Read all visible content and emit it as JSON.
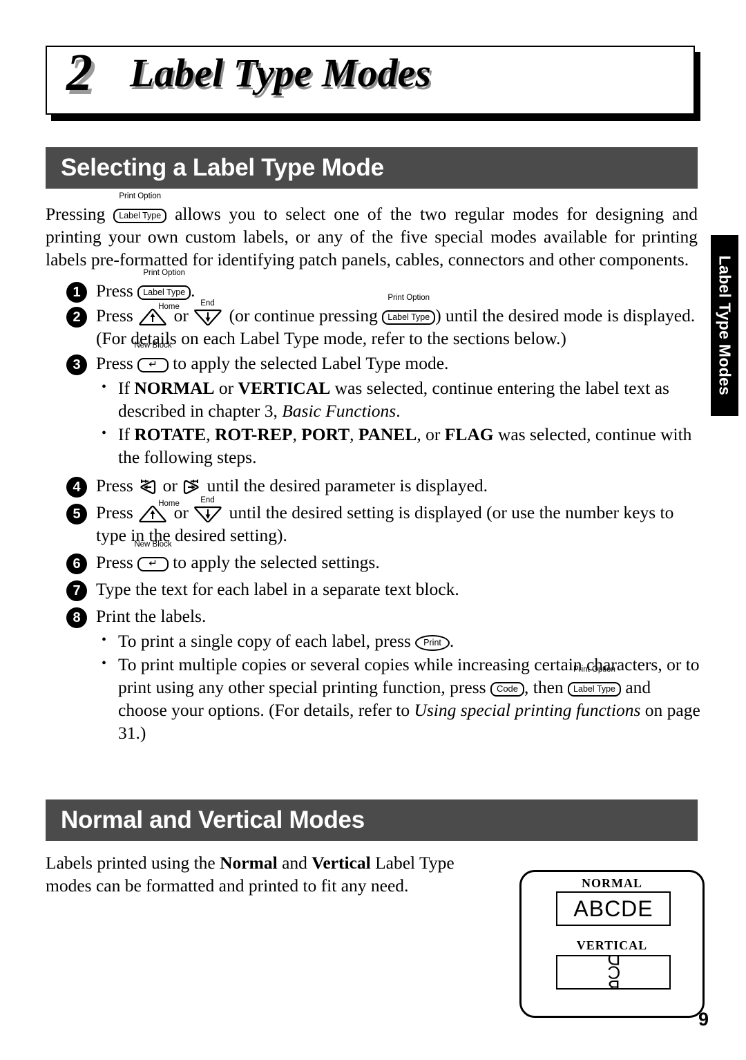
{
  "chapter": {
    "number": "2",
    "title": "Label Type Modes"
  },
  "side_tab": {
    "label": "Label Type Modes"
  },
  "sections": [
    {
      "banner": "Selecting a Label Type Mode"
    },
    {
      "banner": "Normal and Vertical Modes"
    }
  ],
  "intro": {
    "part1": "Pressing ",
    "part2": " allows you to select one of the two regular modes for designing and printing your own custom labels, or any of the five special modes available for printing labels pre-formatted for identifying patch panels, cables, connectors and other components."
  },
  "keys": {
    "label_type": {
      "cap": "Label Type",
      "sup": "Print Option"
    },
    "up": {
      "cap": "↑",
      "sup": "Home"
    },
    "down": {
      "cap": "↓",
      "sup": "End"
    },
    "left": {
      "cap": "←"
    },
    "right": {
      "cap": "→"
    },
    "new_block": {
      "cap": "↵",
      "sup": "New Block"
    },
    "print": {
      "cap": "Print"
    },
    "code": {
      "cap": "Code"
    }
  },
  "steps": [
    {
      "num": "1",
      "pre": "Press ",
      "post": "."
    },
    {
      "num": "2",
      "pre": "Press ",
      "mid1": " or ",
      "mid2": " (or continue pressing ",
      "post": ") until the desired mode is displayed. (For details on each Label Type mode, refer to the sections below.)"
    },
    {
      "num": "3",
      "pre": "Press ",
      "post": " to apply the selected Label Type mode."
    },
    {
      "num": "4",
      "pre": "Press ",
      "mid1": " or ",
      "post": " until the desired parameter is displayed."
    },
    {
      "num": "5",
      "pre": "Press ",
      "mid1": " or ",
      "post": " until the desired setting is displayed (or use the number keys to type in the desired setting)."
    },
    {
      "num": "6",
      "pre": "Press ",
      "post": " to apply the selected settings."
    },
    {
      "num": "7",
      "pre": "Type the text for each label in a separate text block."
    },
    {
      "num": "8",
      "pre": "Print the labels."
    }
  ],
  "bullets_after_step3": [
    {
      "a": "If ",
      "b1": "NORMAL",
      "c": " or ",
      "b2": "VERTICAL",
      "d": " was selected, continue entering the label text as described in chapter 3, ",
      "italic": "Basic Functions",
      "e": "."
    },
    {
      "a": "If ",
      "b1": "ROTATE",
      "sep1": ", ",
      "b2": "ROT-REP",
      "sep2": ", ",
      "b3": "PORT",
      "sep3": ", ",
      "b4": "PANEL",
      "sep4": ", or ",
      "b5": "FLAG",
      "e": " was selected, continue with the following steps."
    }
  ],
  "bullets_after_step8": [
    {
      "pre": "To print a single copy of each label, press ",
      "post": "."
    },
    {
      "pre": "To print multiple copies or several copies while increasing certain characters, or to print using any other special printing function, press ",
      "mid": ", then ",
      "post1": " and choose your options. (For details, refer to ",
      "italic": "Using special printing functions",
      "post2": " on page 31.)"
    }
  ],
  "normal_vertical": {
    "a": "Labels printed using the ",
    "b1": "Normal",
    "c": " and ",
    "b2": "Vertical",
    "d": " Label Type modes can be formatted and printed to fit any need."
  },
  "figure": {
    "normal_label": "NORMAL",
    "normal_value": "ABCDE",
    "vertical_label": "VERTICAL",
    "vertical_value": "ABCDE"
  },
  "page_number": "9",
  "colors": {
    "banner_gray": "#4b4b4b",
    "tab_black": "#000000",
    "shadow_gray": "#9a9a9a"
  }
}
